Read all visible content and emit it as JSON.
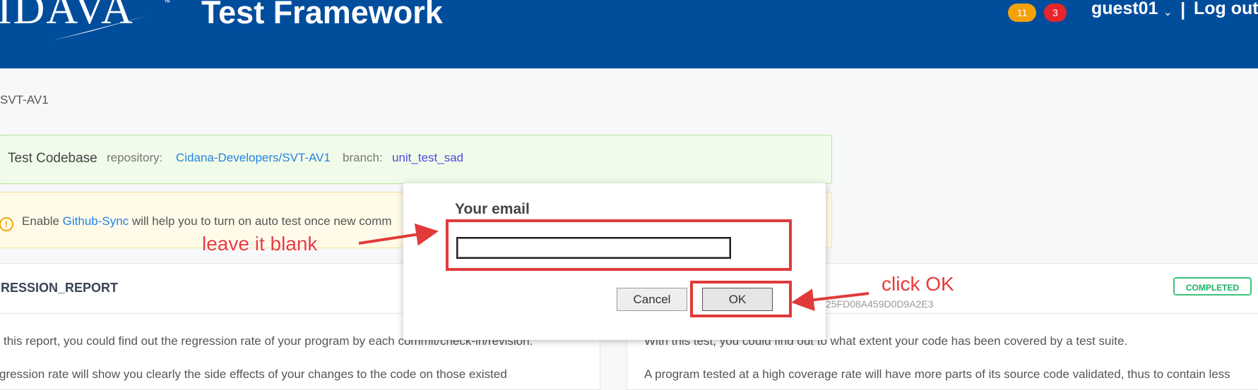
{
  "header": {
    "logo_text": "IDAVA",
    "logo_tm": "™",
    "title": "Test Framework",
    "notifications": [
      {
        "count": "11",
        "color": "#f4a10a"
      },
      {
        "count": "3",
        "color": "#e8252b"
      }
    ],
    "user": "guest01",
    "user_caret": "⌄",
    "divider": "|",
    "logout_label": "Log out"
  },
  "breadcrumb": "SVT-AV1",
  "codebase": {
    "title": "Test Codebase",
    "repo_label": "repository:",
    "repo_value": "Cidana-Developers/SVT-AV1",
    "branch_label": "branch:",
    "branch_value": "unit_test_sad"
  },
  "notice": {
    "icon": "warning-icon",
    "prefix": "Enable",
    "link": "Github-Sync",
    "suffix": "will help you to turn on auto test once new comm"
  },
  "cards": {
    "left": {
      "title": "RESSION_REPORT",
      "line1": "this report, you could find out the regression rate of your program by each commit/check-in/revision.",
      "line2": "gression rate will show you clearly the side effects of your changes to the code on those existed"
    },
    "right": {
      "status": "COMPLETED",
      "id": "25FD08A459D0D9A2E3",
      "line1": "With this test, you could find out to what extent your code has been covered by a test suite.",
      "line2": "A program tested at a high coverage rate will have more parts of its source code validated, thus to contain less"
    }
  },
  "dialog": {
    "label": "Your email",
    "input_value": "",
    "cancel_label": "Cancel",
    "ok_label": "OK"
  },
  "annotations": {
    "leave_blank": "leave it blank",
    "click_ok": "click OK",
    "color": "#e03a3a"
  }
}
